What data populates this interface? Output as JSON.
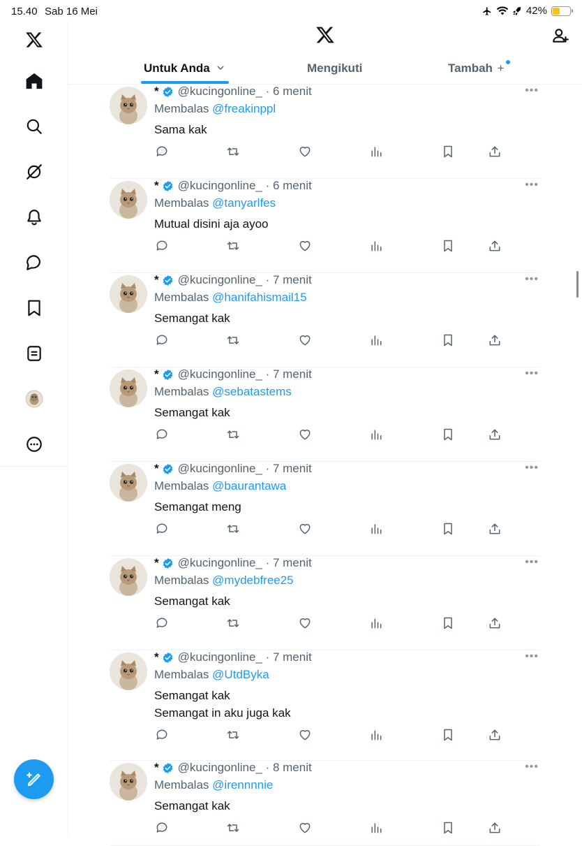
{
  "status_bar": {
    "time": "15.40",
    "date": "Sab 16 Mei",
    "battery": "42%",
    "battery_level": 0.42
  },
  "sidebar": {
    "items": [
      {
        "name": "logo",
        "icon": "x-logo"
      },
      {
        "name": "home",
        "icon": "home-icon"
      },
      {
        "name": "search",
        "icon": "search-icon"
      },
      {
        "name": "grok",
        "icon": "grok-icon"
      },
      {
        "name": "notifications",
        "icon": "bell-icon"
      },
      {
        "name": "messages",
        "icon": "message-icon"
      },
      {
        "name": "bookmarks",
        "icon": "bookmark-icon"
      },
      {
        "name": "lists",
        "icon": "list-icon"
      },
      {
        "name": "profile",
        "icon": "avatar"
      },
      {
        "name": "more",
        "icon": "more-circle-icon"
      }
    ]
  },
  "header": {
    "tabs": [
      {
        "label": "Untuk Anda",
        "active": true
      },
      {
        "label": "Mengikuti",
        "active": false
      },
      {
        "label": "Tambah",
        "active": false
      }
    ]
  },
  "colors": {
    "accent": "#1d9bf0",
    "muted": "#536471",
    "divider": "#eff3f4"
  },
  "tweets": [
    {
      "name": "*",
      "handle": "@kucingonline_",
      "time": "6 menit",
      "reply_prefix": "Membalas",
      "reply_to": "@freakinppl",
      "lines": [
        "Sama kak"
      ]
    },
    {
      "name": "*",
      "handle": "@kucingonline_",
      "time": "6 menit",
      "reply_prefix": "Membalas",
      "reply_to": "@tanyarlfes",
      "lines": [
        "Mutual disini aja ayoo"
      ]
    },
    {
      "name": "*",
      "handle": "@kucingonline_",
      "time": "7 menit",
      "reply_prefix": "Membalas",
      "reply_to": "@hanifahismail15",
      "lines": [
        "Semangat kak"
      ]
    },
    {
      "name": "*",
      "handle": "@kucingonline_",
      "time": "7 menit",
      "reply_prefix": "Membalas",
      "reply_to": "@sebatastems",
      "lines": [
        "Semangat kak"
      ]
    },
    {
      "name": "*",
      "handle": "@kucingonline_",
      "time": "7 menit",
      "reply_prefix": "Membalas",
      "reply_to": "@baurantawa",
      "lines": [
        "Semangat meng"
      ]
    },
    {
      "name": "*",
      "handle": "@kucingonline_",
      "time": "7 menit",
      "reply_prefix": "Membalas",
      "reply_to": "@mydebfree25",
      "lines": [
        "Semangat kak"
      ]
    },
    {
      "name": "*",
      "handle": "@kucingonline_",
      "time": "7 menit",
      "reply_prefix": "Membalas",
      "reply_to": "@UtdByka",
      "lines": [
        "Semangat kak",
        "Semangat in aku juga kak"
      ]
    },
    {
      "name": "*",
      "handle": "@kucingonline_",
      "time": "8 menit",
      "reply_prefix": "Membalas",
      "reply_to": "@irennnnie",
      "lines": [
        "Semangat kak"
      ]
    }
  ]
}
